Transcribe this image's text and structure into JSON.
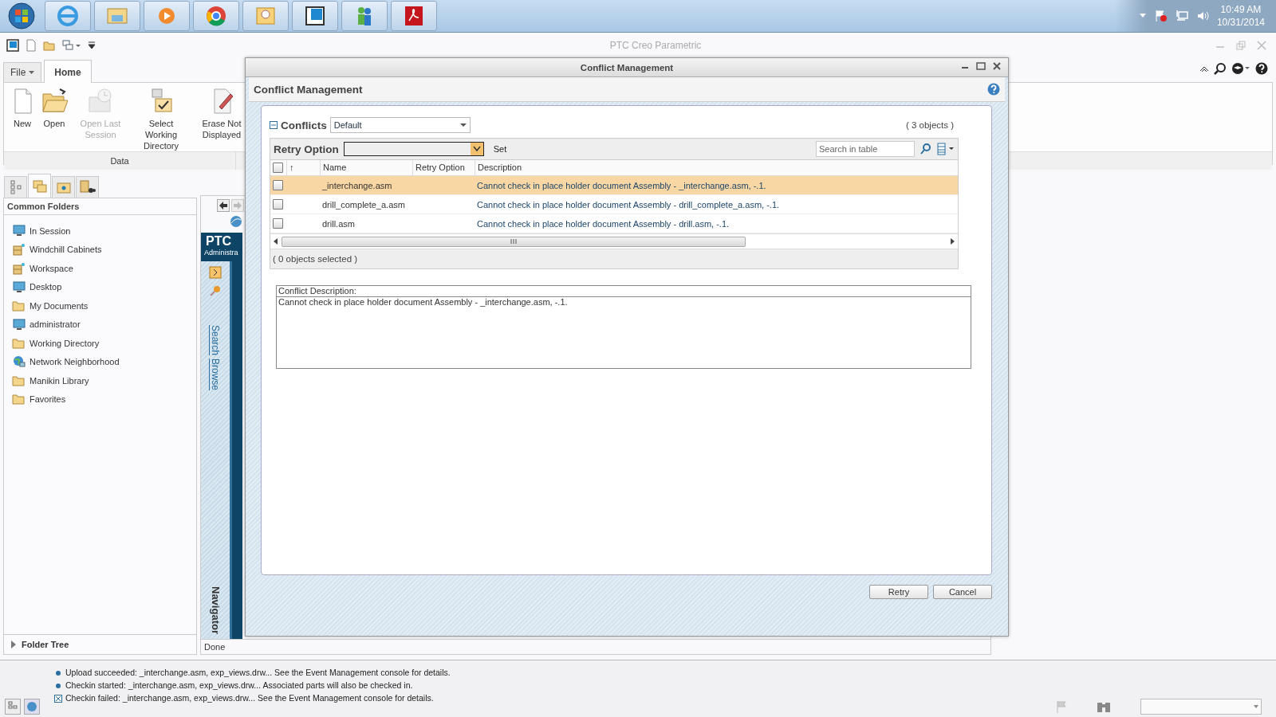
{
  "taskbar": {
    "time": "10:49 AM",
    "date": "10/31/2014"
  },
  "app": {
    "title": "PTC Creo Parametric",
    "ribbon_tabs": [
      {
        "label": "File",
        "selected": false
      },
      {
        "label": "Home",
        "selected": true
      }
    ],
    "ribbon_buttons": [
      {
        "label": "New",
        "kind": "new",
        "disabled": false
      },
      {
        "label": "Open",
        "kind": "open",
        "disabled": false
      },
      {
        "label": "Open Last Session",
        "kind": "session",
        "disabled": true
      },
      {
        "label": "Select Working Directory",
        "kind": "directory",
        "disabled": false
      },
      {
        "label": "Erase Not Displayed",
        "kind": "erase",
        "disabled": false
      }
    ],
    "ribbon_group": "Data"
  },
  "navigator": {
    "tabs": [
      {
        "kind": "tree",
        "selected": false
      },
      {
        "kind": "folders",
        "selected": true
      },
      {
        "kind": "favorites",
        "selected": false
      },
      {
        "kind": "search",
        "selected": false
      }
    ],
    "header": "Common Folders",
    "folders": [
      {
        "label": "In Session",
        "kind": "monitor"
      },
      {
        "label": "Windchill Cabinets",
        "kind": "cabinet"
      },
      {
        "label": "Workspace",
        "kind": "cabinet"
      },
      {
        "label": "Desktop",
        "kind": "monitor"
      },
      {
        "label": "My Documents",
        "kind": "folder"
      },
      {
        "label": "administrator",
        "kind": "monitor"
      },
      {
        "label": "Working Directory",
        "kind": "folder"
      },
      {
        "label": "Network Neighborhood",
        "kind": "globe"
      },
      {
        "label": "Manikin Library",
        "kind": "folder"
      },
      {
        "label": "Favorites",
        "kind": "folder"
      }
    ],
    "footer": "Folder Tree"
  },
  "browser": {
    "logo": "PTC",
    "subtitle": "Administra",
    "links": [
      "Search",
      "Browse"
    ],
    "sidebar_title": "Navigator",
    "status": "Done"
  },
  "dialog": {
    "window_title": "Conflict Management",
    "heading": "Conflict Management",
    "conflicts_label": "Conflicts",
    "view": "Default",
    "count": "( 3 objects )",
    "retry_label": "Retry Option",
    "set_label": "Set",
    "search_placeholder": "Search in table",
    "sort_indicator": "↑",
    "all_checked": false,
    "columns": [
      "Name",
      "Retry Option",
      "Description"
    ],
    "rows": [
      {
        "name": "_interchange.asm",
        "description": "Cannot check in place holder document Assembly  - _interchange.asm, -.1.",
        "selected": true,
        "checked": false
      },
      {
        "name": "drill_complete_a.asm",
        "description": "Cannot check in place holder document Assembly  - drill_complete_a.asm, -.1.",
        "selected": false,
        "checked": false
      },
      {
        "name": "drill.asm",
        "description": "Cannot check in place holder document Assembly  - drill.asm, -.1.",
        "selected": false,
        "checked": false
      }
    ],
    "selection_count": "( 0 objects selected )",
    "description_label": "Conflict Description:",
    "description_text": "Cannot check in place holder document Assembly  - _interchange.asm, -.1.",
    "buttons": [
      "Retry",
      "Cancel"
    ]
  },
  "status_messages": [
    {
      "kind": "info",
      "text": "Upload succeeded: _interchange.asm, exp_views.drw... See the Event Management console for details."
    },
    {
      "kind": "info",
      "text": "Checkin started: _interchange.asm, exp_views.drw... Associated parts will also be checked in."
    },
    {
      "kind": "error",
      "text": "Checkin failed: _interchange.asm, exp_views.drw... See the Event Management console for details."
    }
  ]
}
